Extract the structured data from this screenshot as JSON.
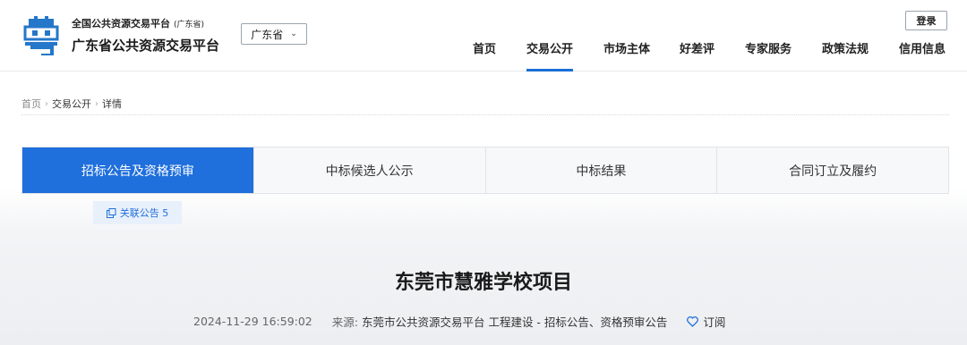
{
  "brand": {
    "small_title": "全国公共资源交易平台",
    "small_sub": "(广东省)",
    "main_title": "广东省公共资源交易平台"
  },
  "province_select": {
    "value": "广东省"
  },
  "login_label": "登录",
  "nav": [
    {
      "label": "首页"
    },
    {
      "label": "交易公开"
    },
    {
      "label": "市场主体"
    },
    {
      "label": "好差评"
    },
    {
      "label": "专家服务"
    },
    {
      "label": "政策法规"
    },
    {
      "label": "信用信息"
    }
  ],
  "breadcrumb": [
    "首页",
    "交易公开",
    "详情"
  ],
  "tabs": [
    {
      "label": "招标公告及资格预审"
    },
    {
      "label": "中标候选人公示"
    },
    {
      "label": "中标结果"
    },
    {
      "label": "合同订立及履约"
    }
  ],
  "related": {
    "label": "关联公告 5"
  },
  "article": {
    "title": "东莞市慧雅学校项目",
    "date": "2024-11-29 16:59:02",
    "source_label": "来源:",
    "source_value": "东莞市公共资源交易平台 工程建设 - 招标公告、资格预审公告",
    "subscribe_label": "订阅"
  },
  "colors": {
    "accent": "#1f6fdc",
    "logo_blue": "#2577c9"
  }
}
